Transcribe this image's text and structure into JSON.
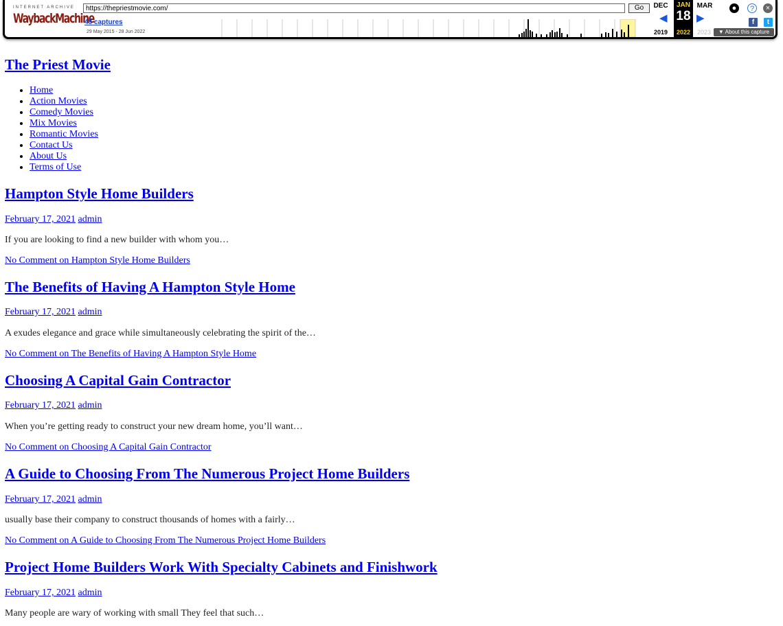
{
  "wayback": {
    "ia_label": "INTERNET ARCHIVE",
    "wm_label": "WaybackMachine",
    "url": "https://thepriestmovie.com/",
    "go_label": "Go",
    "captures": "48 captures",
    "date_range": "29 May 2015 - 28 Jun 2022",
    "prev_month": "DEC",
    "cur_month": "JAN",
    "next_month": "MAR",
    "cur_day": "18",
    "prev_year": "2019",
    "cur_year": "2022",
    "next_year": "2023",
    "about": "About this capture",
    "icons": [
      "user-icon",
      "help-icon",
      "close-icon",
      "facebook-icon",
      "twitter-icon"
    ]
  },
  "site": {
    "title": "The Priest Movie",
    "nav": [
      "Home",
      "Action Movies",
      "Comedy Movies",
      "Mix Movies",
      "Romantic Movies",
      "Contact Us",
      "About Us",
      "Terms of Use"
    ]
  },
  "posts": [
    {
      "title": "Hampton Style Home Builders",
      "date": "February 17, 2021",
      "author": "admin",
      "excerpt": "If you are looking to find a new builder with whom you…",
      "comment": "No Comment on Hampton Style Home Builders"
    },
    {
      "title": "The Benefits of Having A Hampton Style Home",
      "date": "February 17, 2021",
      "author": "admin",
      "excerpt": "A exudes elegance and grace while simultaneously celebrating the spirit of the…",
      "comment": "No Comment on The Benefits of Having A Hampton Style Home"
    },
    {
      "title": "Choosing A Capital Gain Contractor",
      "date": "February 17, 2021",
      "author": "admin",
      "excerpt": "When you’re getting ready to construct your new dream home, you’ll want…",
      "comment": "No Comment on Choosing A Capital Gain Contractor"
    },
    {
      "title": "A Guide to Choosing From The Numerous Project Home Builders",
      "date": "February 17, 2021",
      "author": "admin",
      "excerpt": "usually base their company to construct thousands of homes with a fairly…",
      "comment": "No Comment on A Guide to Choosing From The Numerous Project Home Builders"
    },
    {
      "title": "Project Home Builders Work With Specialty Cabinets and Finishwork",
      "date": "February 17, 2021",
      "author": "admin",
      "excerpt": "Many people are wary of working with small They feel that such…",
      "comment": ""
    }
  ]
}
